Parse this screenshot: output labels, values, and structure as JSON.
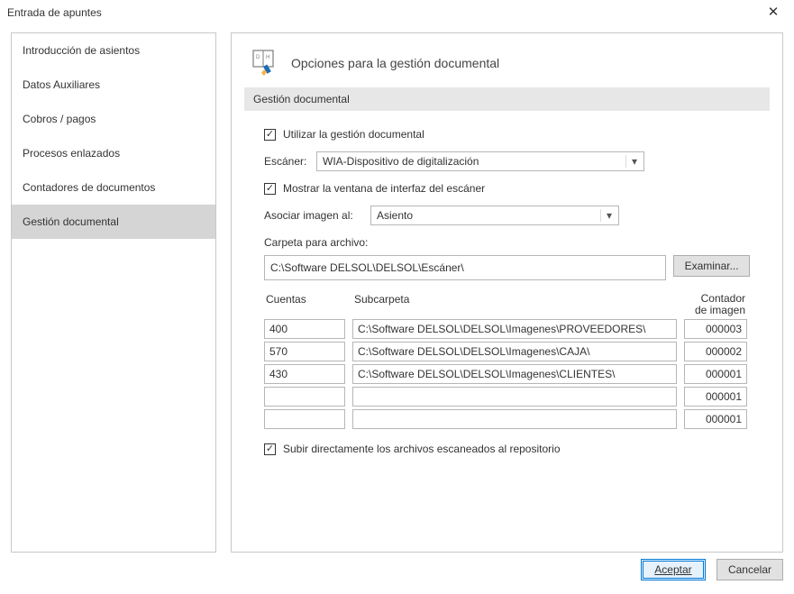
{
  "window": {
    "title": "Entrada de apuntes",
    "close": "✕"
  },
  "sidebar": {
    "items": [
      {
        "label": "Introducción de asientos"
      },
      {
        "label": "Datos Auxiliares"
      },
      {
        "label": "Cobros / pagos"
      },
      {
        "label": "Procesos enlazados"
      },
      {
        "label": "Contadores de documentos"
      },
      {
        "label": "Gestión documental"
      }
    ],
    "selected_index": 5
  },
  "page": {
    "title": "Opciones para la gestión documental",
    "section": "Gestión documental",
    "use_gestion_label": "Utilizar la gestión documental",
    "scanner_label": "Escáner:",
    "scanner_value": "WIA-Dispositivo de digitalización",
    "show_interface_label": "Mostrar la ventana de interfaz del escáner",
    "asociar_label": "Asociar imagen al:",
    "asociar_value": "Asiento",
    "folder_label": "Carpeta para archivo:",
    "folder_value": "C:\\Software DELSOL\\DELSOL\\Escáner\\",
    "browse": "Examinar...",
    "grid": {
      "headers": {
        "cuentas": "Cuentas",
        "subcarpeta": "Subcarpeta",
        "contador_line1": "Contador",
        "contador_line2": "de imagen"
      },
      "rows": [
        {
          "cuenta": "400",
          "subcarpeta": "C:\\Software DELSOL\\DELSOL\\Imagenes\\PROVEEDORES\\",
          "contador": "000003"
        },
        {
          "cuenta": "570",
          "subcarpeta": "C:\\Software DELSOL\\DELSOL\\Imagenes\\CAJA\\",
          "contador": "000002"
        },
        {
          "cuenta": "430",
          "subcarpeta": "C:\\Software DELSOL\\DELSOL\\Imagenes\\CLIENTES\\",
          "contador": "000001"
        },
        {
          "cuenta": "",
          "subcarpeta": "",
          "contador": "000001"
        },
        {
          "cuenta": "",
          "subcarpeta": "",
          "contador": "000001"
        }
      ]
    },
    "upload_label": "Subir directamente los archivos escaneados al repositorio"
  },
  "footer": {
    "accept": "Aceptar",
    "cancel": "Cancelar"
  },
  "icons": {
    "dh": "D  H"
  }
}
